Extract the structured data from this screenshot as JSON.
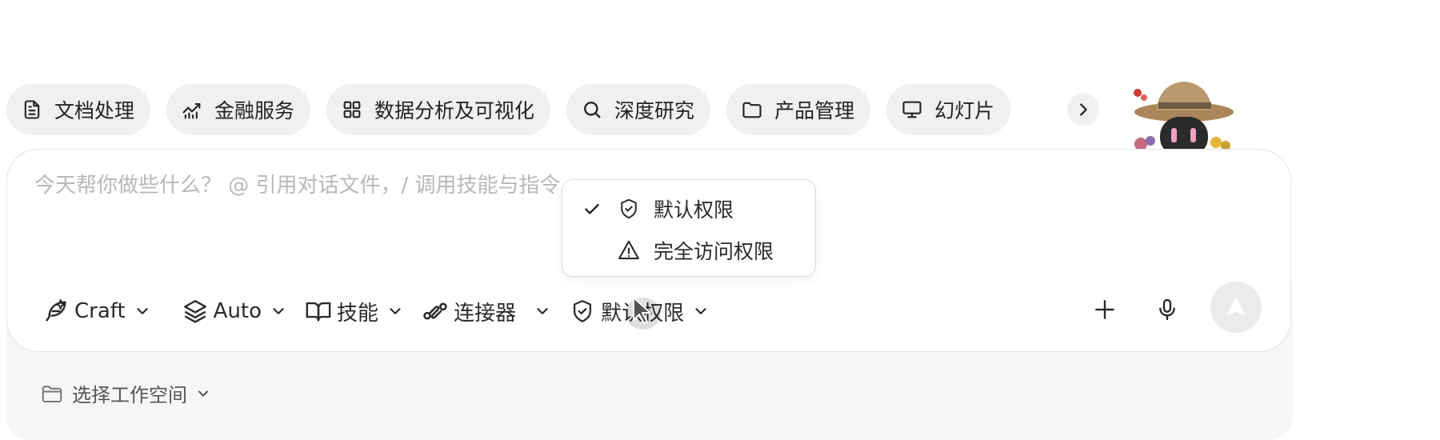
{
  "chips": [
    {
      "label": "文档处理",
      "icon": "document-icon"
    },
    {
      "label": "金融服务",
      "icon": "chart-line-icon"
    },
    {
      "label": "数据分析及可视化",
      "icon": "grid-icon"
    },
    {
      "label": "深度研究",
      "icon": "search-icon"
    },
    {
      "label": "产品管理",
      "icon": "folder-icon"
    },
    {
      "label": "幻灯片",
      "icon": "monitor-icon"
    }
  ],
  "chips_next_icon": "chevron-right-icon",
  "prompt": {
    "placeholder": "今天帮你做些什么？ @ 引用对话文件，/ 调用技能与指令"
  },
  "toolbar": {
    "craft": "Craft",
    "auto": "Auto",
    "skills": "技能",
    "connectors": "连接器",
    "permissions": "默认权限"
  },
  "permission_menu": {
    "items": [
      {
        "label": "默认权限",
        "icon": "shield-check-icon",
        "selected": true
      },
      {
        "label": "完全访问权限",
        "icon": "warning-icon",
        "selected": false
      }
    ]
  },
  "workspace": {
    "label": "选择工作空间"
  }
}
